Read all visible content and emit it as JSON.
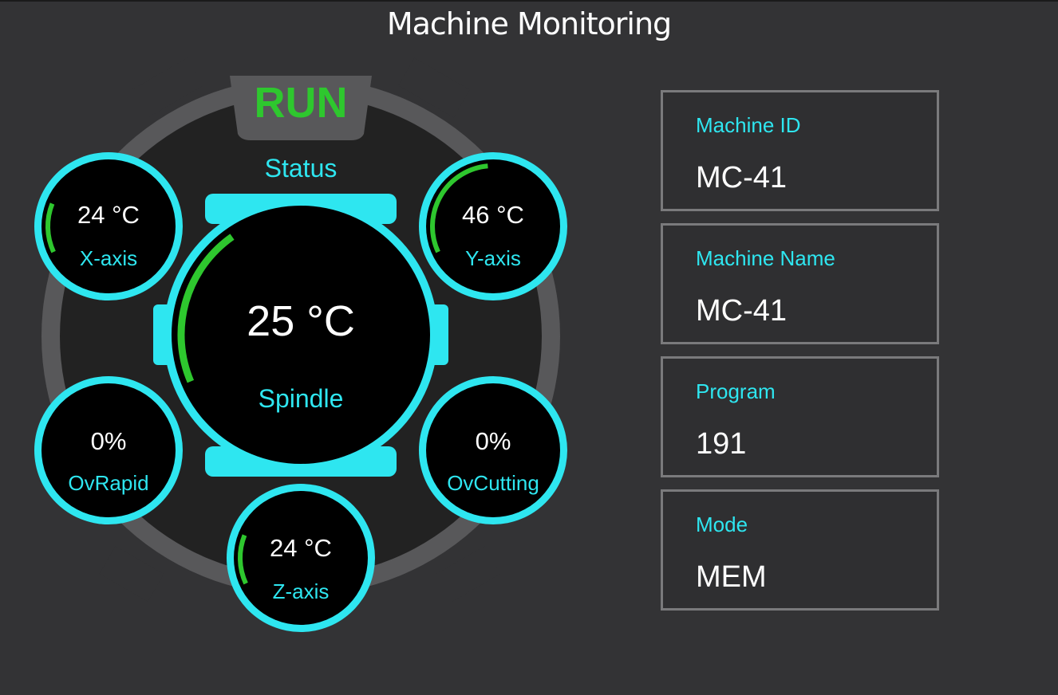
{
  "app": {
    "title": "Machine Monitoring"
  },
  "colors": {
    "background": "#333335",
    "accent_cyan": "#2ee6f0",
    "status_green": "#2ec72e",
    "text_white": "#ffffff",
    "card_border": "#7a7a7c",
    "ring_gray": "#58585a",
    "dial_dark": "#222222"
  },
  "status": {
    "value": "RUN",
    "label": "Status"
  },
  "spindle": {
    "value": "25 °C",
    "label": "Spindle"
  },
  "gauges": {
    "x_axis": {
      "value": "24 °C",
      "label": "X-axis"
    },
    "y_axis": {
      "value": "46 °C",
      "label": "Y-axis"
    },
    "z_axis": {
      "value": "24 °C",
      "label": "Z-axis"
    },
    "ov_rapid": {
      "value": "0%",
      "label": "OvRapid"
    },
    "ov_cutting": {
      "value": "0%",
      "label": "OvCutting"
    }
  },
  "info": {
    "machine_id": {
      "label": "Machine ID",
      "value": "MC-41"
    },
    "machine_name": {
      "label": "Machine Name",
      "value": "MC-41"
    },
    "program": {
      "label": "Program",
      "value": "191"
    },
    "mode": {
      "label": "Mode",
      "value": "MEM"
    }
  }
}
